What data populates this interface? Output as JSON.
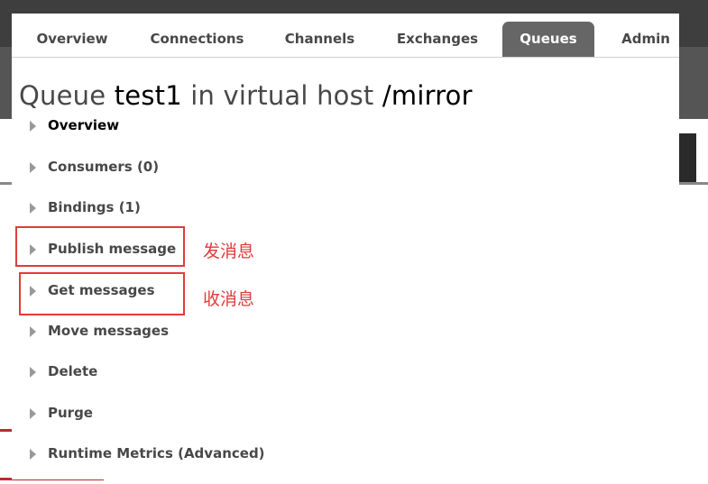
{
  "nav": {
    "tabs": [
      {
        "label": "Overview",
        "active": false
      },
      {
        "label": "Connections",
        "active": false
      },
      {
        "label": "Channels",
        "active": false
      },
      {
        "label": "Exchanges",
        "active": false
      },
      {
        "label": "Queues",
        "active": true
      },
      {
        "label": "Admin",
        "active": false
      }
    ]
  },
  "page": {
    "title_prefix": "Queue ",
    "queue_name": "test1",
    "title_middle": " in virtual host ",
    "vhost": "/mirror"
  },
  "sections": [
    {
      "label": "Overview"
    },
    {
      "label": "Consumers (0)"
    },
    {
      "label": "Bindings (1)"
    },
    {
      "label": "Publish message"
    },
    {
      "label": "Get messages"
    },
    {
      "label": "Move messages"
    },
    {
      "label": "Delete"
    },
    {
      "label": "Purge"
    },
    {
      "label": "Runtime Metrics (Advanced)"
    }
  ],
  "annotations": {
    "publish": "发消息",
    "get": "收消息"
  },
  "colors": {
    "active_tab": "#666666",
    "annotation": "#e23b3b",
    "text": "#484848"
  }
}
